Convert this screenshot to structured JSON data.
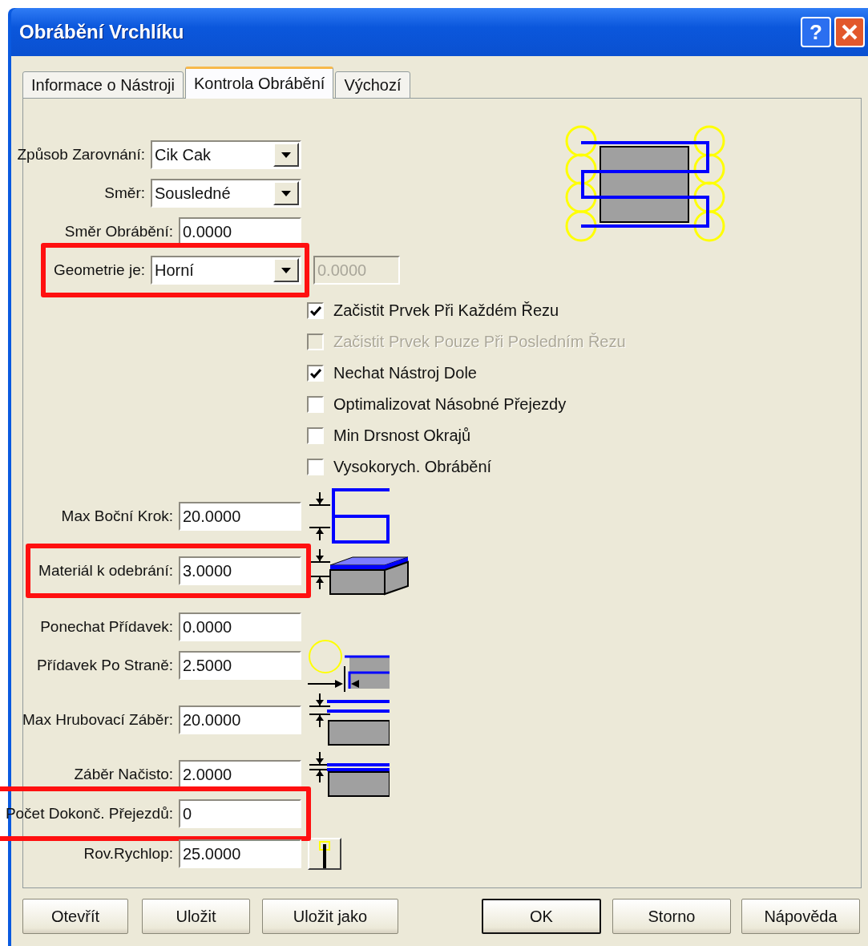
{
  "window": {
    "title": "Obrábění Vrchlíku",
    "help_button": "?"
  },
  "tabs": [
    {
      "label": "Informace o Nástroji",
      "selected": false
    },
    {
      "label": "Kontrola Obrábění",
      "selected": true
    },
    {
      "label": "Výchozí",
      "selected": false
    }
  ],
  "top_fields": [
    {
      "kind": "combo",
      "label": "Způsob Zarovnání:",
      "value": "Cik Cak",
      "highlighted": false
    },
    {
      "kind": "combo",
      "label": "Směr:",
      "value": "Sousledné",
      "highlighted": false
    },
    {
      "kind": "text",
      "label": "Směr Obrábění:",
      "value": "0.0000",
      "highlighted": false
    },
    {
      "kind": "combo",
      "label": "Geometrie je:",
      "value": "Horní",
      "highlighted": true,
      "extra": {
        "value": "0.0000",
        "disabled": true
      }
    }
  ],
  "checkboxes": [
    {
      "label": "Začistit Prvek Při Každém Řezu",
      "checked": true,
      "disabled": false
    },
    {
      "label": "Začistit Prvek Pouze Při Posledním Řezu",
      "checked": false,
      "disabled": true
    },
    {
      "label": "Nechat Nástroj Dole",
      "checked": true,
      "disabled": false
    },
    {
      "label": "Optimalizovat Násobné Přejezdy",
      "checked": false,
      "disabled": false
    },
    {
      "label": "Min Drsnost Okrajů",
      "checked": false,
      "disabled": false
    },
    {
      "label": "Vysokorych. Obrábění",
      "checked": false,
      "disabled": false
    }
  ],
  "fields": [
    {
      "label": "Max Boční Krok:",
      "value": "20.0000",
      "highlighted": false
    },
    {
      "label": "Materiál k odebrání:",
      "value": "3.0000",
      "highlighted": true
    },
    {
      "label": "Ponechat Přídavek:",
      "value": "0.0000",
      "highlighted": false
    },
    {
      "label": "Přídavek Po Straně:",
      "value": "2.5000",
      "highlighted": false
    },
    {
      "label": "Max Hrubovací Záběr:",
      "value": "20.0000",
      "highlighted": false
    },
    {
      "label": "Záběr Načisto:",
      "value": "2.0000",
      "highlighted": false
    },
    {
      "label": "Počet Dokonč. Přejezdů:",
      "value": "0",
      "highlighted": true
    },
    {
      "label": "Rov.Rychlop:",
      "value": "25.0000",
      "highlighted": false
    }
  ],
  "buttons": [
    {
      "label": "Otevřít",
      "default": false
    },
    {
      "label": "Uložit",
      "default": false
    },
    {
      "label": "Uložit jako",
      "default": false
    },
    {
      "label": "OK",
      "default": true
    },
    {
      "label": "Storno",
      "default": false
    },
    {
      "label": "Nápověda",
      "default": false
    }
  ]
}
